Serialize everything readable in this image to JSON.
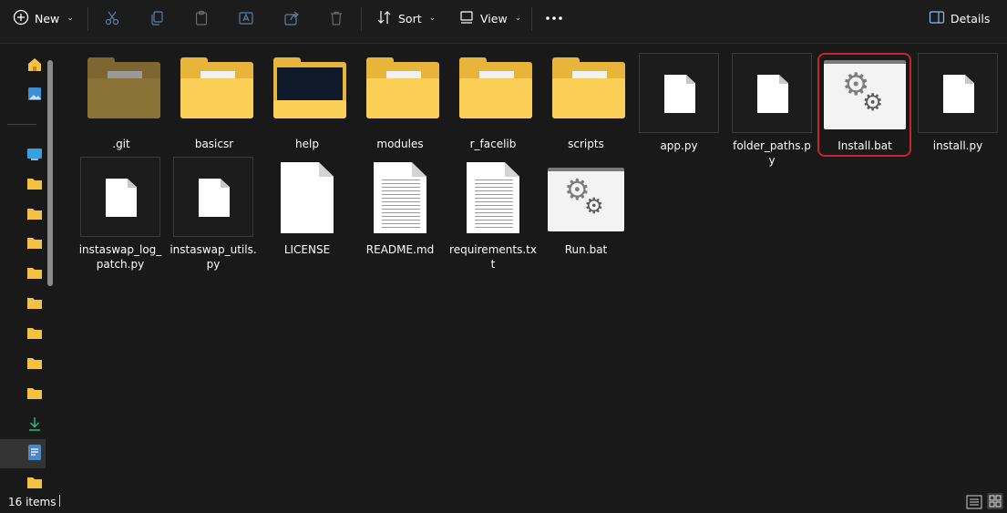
{
  "toolbar": {
    "new_label": "New",
    "sort_label": "Sort",
    "view_label": "View",
    "details_label": "Details"
  },
  "sidebar": {
    "items": [
      {
        "icon": "home-icon"
      },
      {
        "icon": "gallery-icon"
      },
      {
        "icon": "desktop-icon"
      },
      {
        "icon": "folder-icon"
      },
      {
        "icon": "folder-icon"
      },
      {
        "icon": "folder-icon"
      },
      {
        "icon": "folder-icon"
      },
      {
        "icon": "folder-icon"
      },
      {
        "icon": "folder-icon"
      },
      {
        "icon": "folder-icon"
      },
      {
        "icon": "folder-icon"
      },
      {
        "icon": "downloads-icon"
      },
      {
        "icon": "document-icon"
      },
      {
        "icon": "folder-icon"
      }
    ]
  },
  "files": [
    {
      "name": ".git",
      "type": "folder-hidden"
    },
    {
      "name": "basicsr",
      "type": "folder"
    },
    {
      "name": "help",
      "type": "folder-preview"
    },
    {
      "name": "modules",
      "type": "folder"
    },
    {
      "name": "r_facelib",
      "type": "folder"
    },
    {
      "name": "scripts",
      "type": "folder"
    },
    {
      "name": "app.py",
      "type": "file"
    },
    {
      "name": "folder_paths.py",
      "type": "file"
    },
    {
      "name": "Install.bat",
      "type": "batch",
      "highlighted": true
    },
    {
      "name": "install.py",
      "type": "file"
    },
    {
      "name": "instaswap_log_\npatch.py",
      "type": "file"
    },
    {
      "name": "instaswap_utils.\npy",
      "type": "file"
    },
    {
      "name": "LICENSE",
      "type": "document"
    },
    {
      "name": "README.md",
      "type": "text-document"
    },
    {
      "name": "requirements.tx\nt",
      "type": "text-document"
    },
    {
      "name": "Run.bat",
      "type": "batch"
    }
  ],
  "status": {
    "item_count": "16 items"
  },
  "colors": {
    "background": "#191919",
    "highlight": "#c4262e",
    "folder": "#fbcf56"
  }
}
